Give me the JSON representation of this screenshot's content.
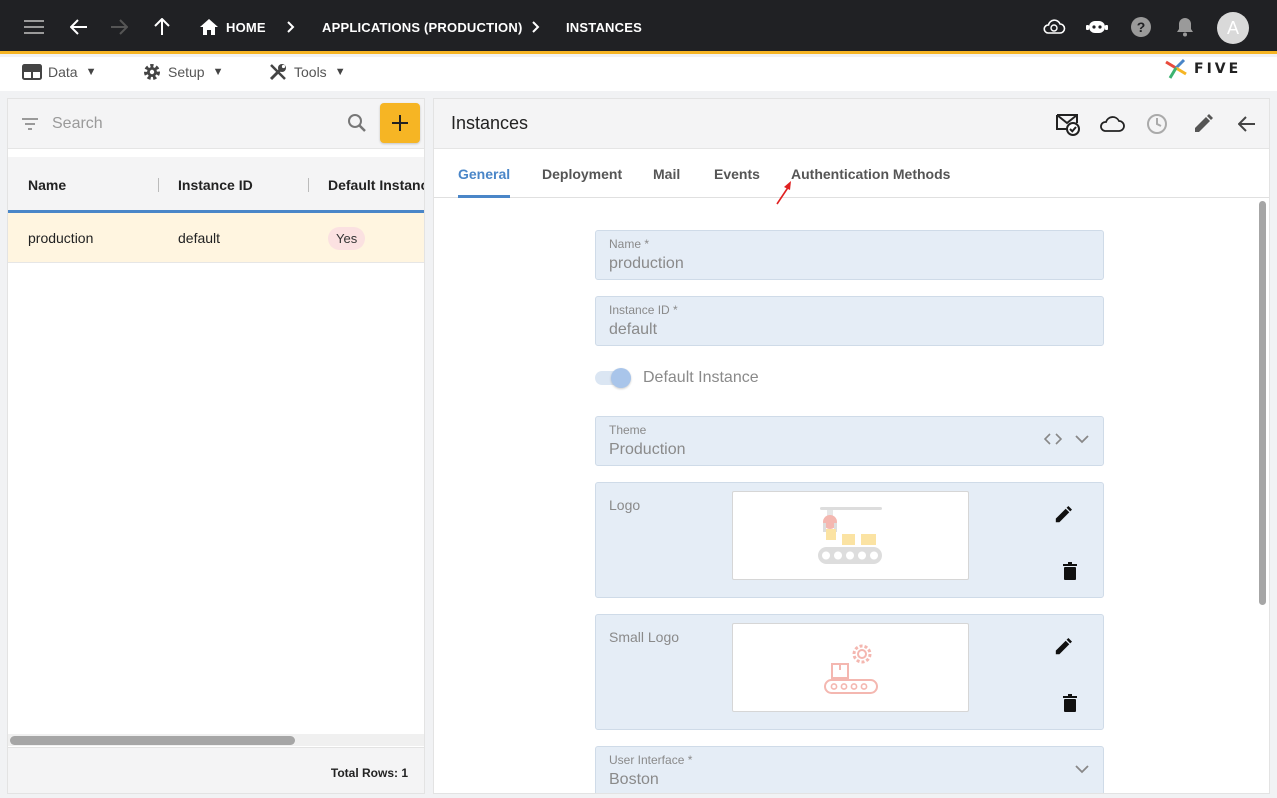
{
  "topbar": {
    "menu_icon": "hamburger-menu-icon",
    "breadcrumbs": [
      {
        "label": "HOME"
      },
      {
        "label": "APPLICATIONS (PRODUCTION)"
      },
      {
        "label": "INSTANCES"
      }
    ],
    "avatar_letter": "A",
    "accent_color": "#f6b524",
    "bar_color": "#202124"
  },
  "menubar": {
    "items": [
      {
        "label": "Data",
        "icon": "table-icon"
      },
      {
        "label": "Setup",
        "icon": "gear-icon"
      },
      {
        "label": "Tools",
        "icon": "wrench-icon"
      }
    ],
    "brand": "FIVE"
  },
  "list": {
    "search_placeholder": "Search",
    "columns": [
      "Name",
      "Instance ID",
      "Default Instanc"
    ],
    "rows": [
      {
        "name": "production",
        "instance_id": "default",
        "default_instance": "Yes"
      }
    ],
    "total_label": "Total Rows: 1"
  },
  "detail": {
    "title": "Instances",
    "tabs": [
      "General",
      "Deployment",
      "Mail",
      "Events",
      "Authentication Methods"
    ],
    "active_tab": "General",
    "fields": {
      "name_label": "Name *",
      "name_value": "production",
      "instance_id_label": "Instance ID *",
      "instance_id_value": "default",
      "default_instance_label": "Default Instance",
      "theme_label": "Theme",
      "theme_value": "Production",
      "logo_label": "Logo",
      "small_logo_label": "Small Logo",
      "user_interface_label": "User Interface *",
      "user_interface_value": "Boston"
    },
    "link_color": "#4a86c8"
  }
}
